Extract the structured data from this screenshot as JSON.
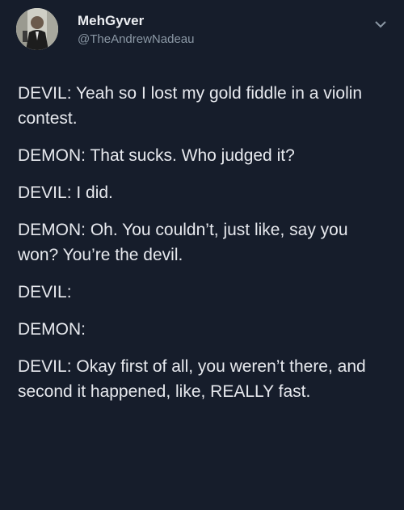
{
  "author": {
    "display_name": "MehGyver",
    "handle": "@TheAndrewNadeau",
    "avatar_icon": "profile-photo"
  },
  "menu_icon": "chevron-down-icon",
  "tweet": {
    "lines": [
      "DEVIL: Yeah so I lost my gold fiddle in a violin contest.",
      "DEMON: That sucks. Who judged it?",
      "DEVIL: I did.",
      "DEMON: Oh. You couldn’t, just like, say you won? You’re the devil.",
      "DEVIL:",
      "DEMON:",
      "DEVIL: Okay first of all, you weren’t there, and second it happened, like, REALLY fast."
    ]
  },
  "colors": {
    "background": "#161d2b",
    "text": "#e7e9ee",
    "secondary_text": "#8b98a5"
  }
}
